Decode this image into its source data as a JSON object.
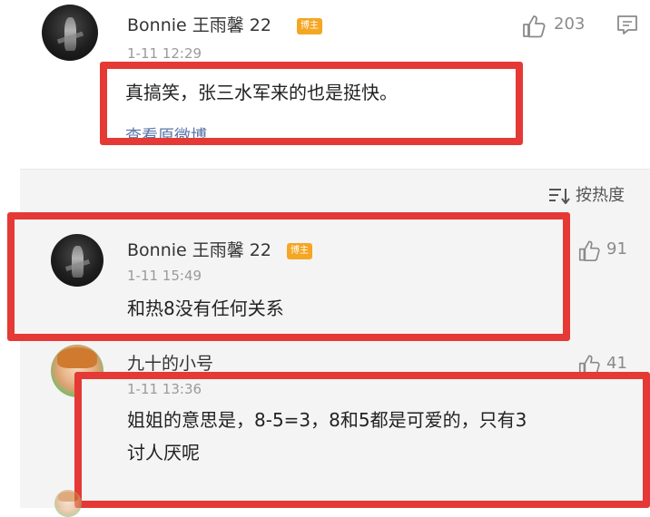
{
  "post": {
    "username": "Bonnie 王雨馨 22",
    "badge": "博主",
    "timestamp": "1-11 12:29",
    "like_count": "203",
    "content": "真搞笑，张三水军来的也是挺快。",
    "view_original": "查看原微博",
    "icons": [
      "thumbs-up-icon",
      "comment-icon"
    ]
  },
  "sort": {
    "label": "按热度",
    "icon": "sort-icon"
  },
  "replies": [
    {
      "username": "Bonnie 王雨馨 22",
      "badge": "博主",
      "timestamp": "1-11 15:49",
      "like_count": "91",
      "content": "和热8没有任何关系"
    },
    {
      "username": "九十的小号",
      "timestamp": "1-11 13:36",
      "like_count": "41",
      "content_line1": "姐姐的意思是，8-5=3，8和5都是可爱的，只有3",
      "content_line2": "讨人厌呢"
    }
  ],
  "colors": {
    "highlight_border": "#e53935",
    "badge_bg": "#f5a623",
    "reply_bg": "#f4f4f4",
    "link": "#5b76a8"
  }
}
